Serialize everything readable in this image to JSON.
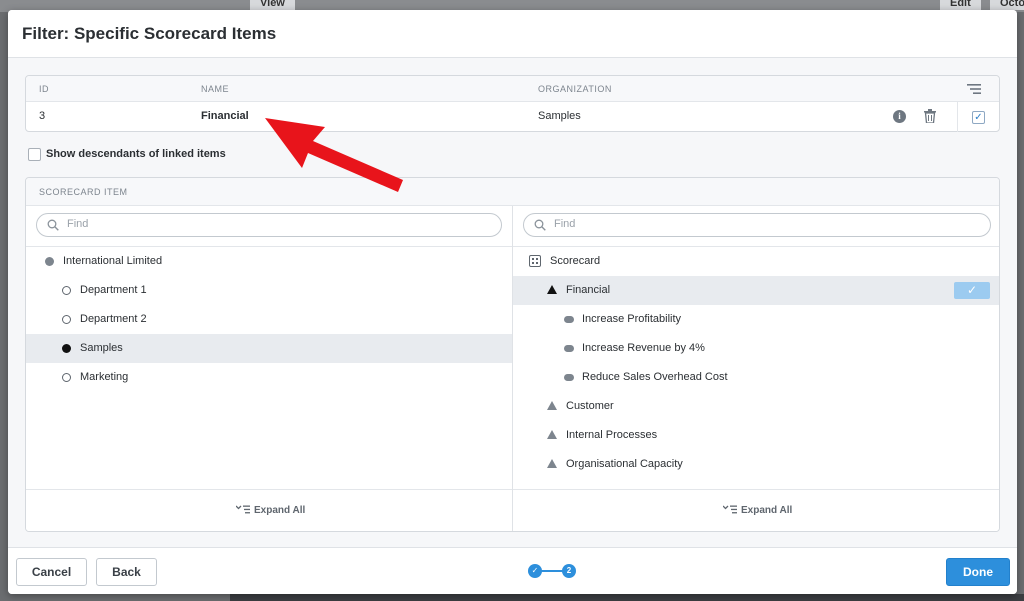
{
  "background": {
    "tabs": [
      "View",
      "Edit",
      "Octo"
    ]
  },
  "dialog": {
    "title": "Filter: Specific Scorecard Items",
    "linked_table": {
      "columns": {
        "id": "ID",
        "name": "NAME",
        "organization": "ORGANIZATION"
      },
      "rows": [
        {
          "id": "3",
          "name": "Financial",
          "organization": "Samples",
          "checked": true
        }
      ]
    },
    "show_descendants": {
      "label": "Show descendants of linked items",
      "checked": false
    },
    "scorecard_panel": {
      "header": "SCORECARD ITEM",
      "left": {
        "search_placeholder": "Find",
        "items": [
          {
            "label": "International Limited",
            "marker": "filled-dot"
          },
          {
            "label": "Department 1",
            "marker": "ring"
          },
          {
            "label": "Department 2",
            "marker": "ring"
          },
          {
            "label": "Samples",
            "marker": "black-dot",
            "selected": true
          },
          {
            "label": "Marketing",
            "marker": "ring"
          }
        ],
        "expand_all": "Expand All"
      },
      "right": {
        "search_placeholder": "Find",
        "items": [
          {
            "label": "Scorecard",
            "marker": "grid-icon"
          },
          {
            "label": "Financial",
            "marker": "black-triangle",
            "selected": true
          },
          {
            "label": "Increase Profitability",
            "marker": "pill"
          },
          {
            "label": "Increase Revenue by 4%",
            "marker": "pill"
          },
          {
            "label": "Reduce Sales Overhead Cost",
            "marker": "pill"
          },
          {
            "label": "Customer",
            "marker": "triangle"
          },
          {
            "label": "Internal Processes",
            "marker": "triangle"
          },
          {
            "label": "Organisational Capacity",
            "marker": "triangle"
          }
        ],
        "expand_all": "Expand All"
      }
    },
    "footer": {
      "cancel": "Cancel",
      "back": "Back",
      "done": "Done",
      "steps": {
        "current": "2"
      }
    }
  },
  "colors": {
    "accent": "#2d8fdc",
    "arrow": "#e8141b"
  }
}
